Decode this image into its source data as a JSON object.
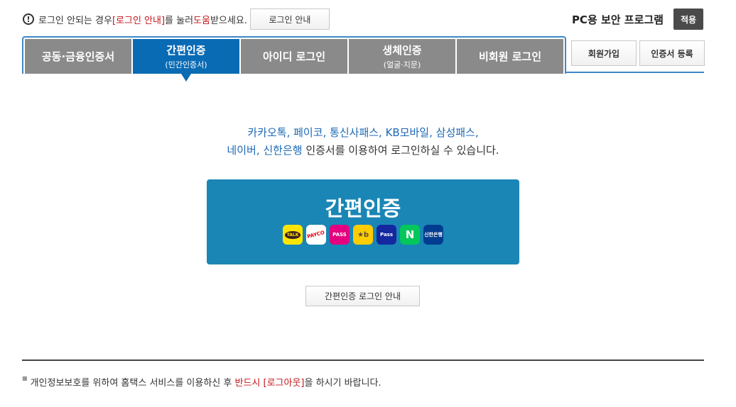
{
  "notice": {
    "pre": "로그인 안되는 경우 ",
    "link": "[로그인 안내]",
    "mid": "를 눌러 ",
    "help": "도움",
    "post": "받으세요.",
    "button": "로그인 안내"
  },
  "security": {
    "label": "PC용 보안 프로그램",
    "apply": "적용"
  },
  "tabs": [
    {
      "label": "공동·금융인증서",
      "sub": ""
    },
    {
      "label": "간편인증",
      "sub": "(민간인증서)"
    },
    {
      "label": "아이디 로그인",
      "sub": ""
    },
    {
      "label": "생체인증",
      "sub": "(얼굴·지문)"
    },
    {
      "label": "비회원 로그인",
      "sub": ""
    }
  ],
  "active_tab": 1,
  "right_buttons": {
    "join": "회원가입",
    "register_cert": "인증서 등록"
  },
  "description": {
    "line1": "카카오톡, 페이코, 통신사패스, KB모바일, 삼성패스,",
    "line2_blue": "네이버, 신한은행",
    "line2_rest": " 인증서를 이용하여 로그인하실 수 있습니다."
  },
  "easy_auth": {
    "title": "간편인증",
    "icons": [
      {
        "name": "kakao-icon",
        "text": "TALK"
      },
      {
        "name": "payco-icon",
        "text": "PAYCO"
      },
      {
        "name": "pass-icon",
        "text": "PASS"
      },
      {
        "name": "kb-icon",
        "text": "★b"
      },
      {
        "name": "samsung-pass-icon",
        "text": "Pass"
      },
      {
        "name": "naver-icon",
        "text": "N"
      },
      {
        "name": "shinhan-icon",
        "text": "신한은행"
      }
    ]
  },
  "guide_button": "간편인증 로그인 안내",
  "footer": {
    "pre": "개인정보보호를 위하여 홈택스 서비스를 이용하신 후 ",
    "red": "반드시 [로그아웃]",
    "post": "을 하시기 바랍니다."
  },
  "colors": {
    "active_tab": "#0a6bb5",
    "tab_inactive": "#8a8a8a",
    "easy_box": "#1a86b5",
    "accent_red": "#c4161c"
  }
}
